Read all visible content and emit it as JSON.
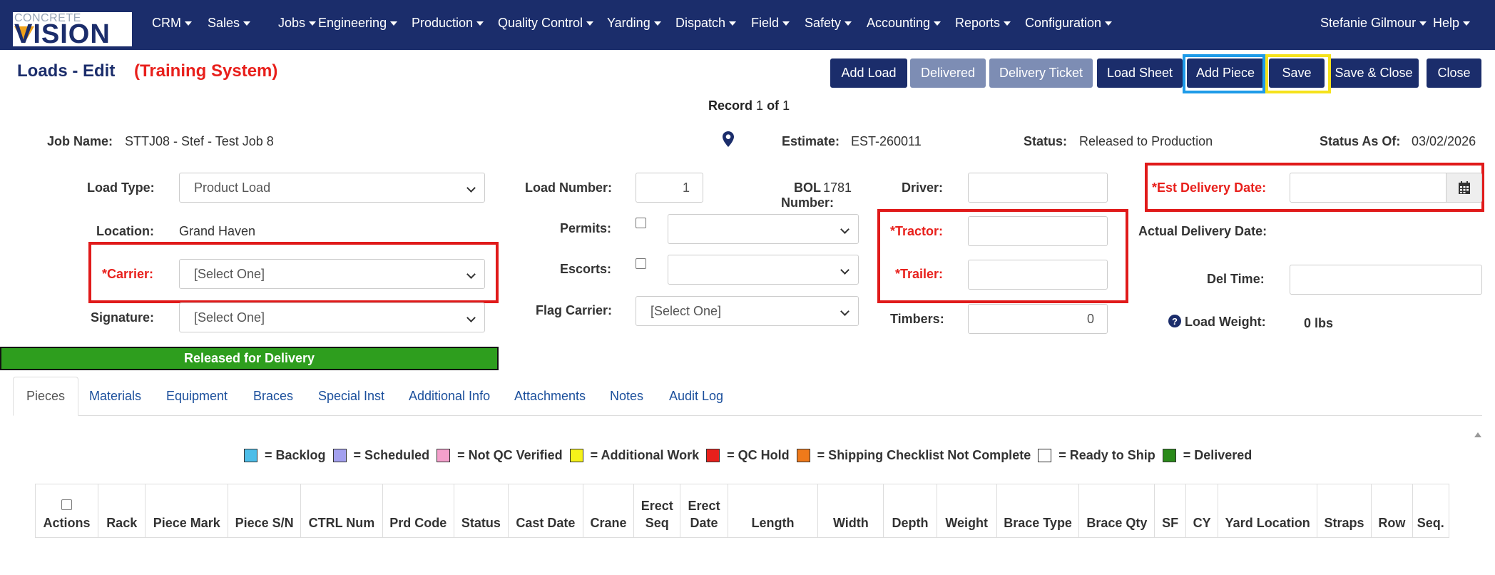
{
  "logo": {
    "top": "CONCRETE",
    "main": "VISION"
  },
  "nav": {
    "items": [
      "CRM",
      "Sales",
      "Jobs",
      "Engineering",
      "Production",
      "Quality Control",
      "Yarding",
      "Dispatch",
      "Field",
      "Safety",
      "Accounting",
      "Reports",
      "Configuration"
    ],
    "user": "Stefanie Gilmour",
    "help": "Help"
  },
  "page": {
    "title": "Loads - Edit",
    "system": "(Training System)"
  },
  "toolbar": {
    "add_load": "Add Load",
    "delivered": "Delivered",
    "delivery_ticket": "Delivery Ticket",
    "load_sheet": "Load Sheet",
    "add_piece": "Add Piece",
    "save": "Save",
    "save_close": "Save & Close",
    "close": "Close"
  },
  "record": {
    "label": "Record",
    "current": "1",
    "of": "of",
    "total": "1"
  },
  "header": {
    "job_name_label": "Job Name:",
    "job_name": "STTJ08 - Stef - Test Job 8",
    "estimate_label": "Estimate:",
    "estimate": "EST-260011",
    "status_label": "Status:",
    "status": "Released to Production",
    "status_as_of_label": "Status As Of:",
    "status_as_of": "03/02/2026"
  },
  "form": {
    "load_type_label": "Load Type:",
    "load_type": "Product Load",
    "location_label": "Location:",
    "location": "Grand Haven",
    "carrier_label": "*Carrier:",
    "carrier": "[Select One]",
    "signature_label": "Signature:",
    "signature": "[Select One]",
    "load_number_label": "Load Number:",
    "load_number": "1",
    "bol_label_1": "BOL",
    "bol_label_2": "Number:",
    "bol_number": "1781",
    "permits_label": "Permits:",
    "escorts_label": "Escorts:",
    "flag_carrier_label": "Flag Carrier:",
    "flag_carrier": "[Select One]",
    "driver_label": "Driver:",
    "tractor_label": "*Tractor:",
    "trailer_label": "*Trailer:",
    "timbers_label": "Timbers:",
    "timbers": "0",
    "est_delivery_label": "*Est Delivery Date:",
    "actual_delivery_label": "Actual Delivery Date:",
    "del_time_label": "Del Time:",
    "load_weight_label": "Load Weight:",
    "load_weight": "0 lbs"
  },
  "status_bar": "Released for Delivery",
  "tabs": [
    "Pieces",
    "Materials",
    "Equipment",
    "Braces",
    "Special Inst",
    "Additional Info",
    "Attachments",
    "Notes",
    "Audit Log"
  ],
  "legend": [
    {
      "label": "= Backlog",
      "color": "#4dbde8"
    },
    {
      "label": "= Scheduled",
      "color": "#a3a0ee"
    },
    {
      "label": "= Not QC Verified",
      "color": "#f4a0cc"
    },
    {
      "label": "= Additional Work",
      "color": "#f6f21a"
    },
    {
      "label": "= QC Hold",
      "color": "#e8201c"
    },
    {
      "label": "= Shipping Checklist Not Complete",
      "color": "#f07a1a"
    },
    {
      "label": "= Ready to Ship",
      "color": "#ffffff"
    },
    {
      "label": "= Delivered",
      "color": "#2a8a1a"
    }
  ],
  "table": {
    "columns": [
      "Actions",
      "Rack",
      "Piece Mark",
      "Piece S/N",
      "CTRL Num",
      "Prd Code",
      "Status",
      "Cast Date",
      "Crane",
      "Erect Seq",
      "Erect Date",
      "Length",
      "Width",
      "Depth",
      "Weight",
      "Brace Type",
      "Brace Qty",
      "SF",
      "CY",
      "Yard Location",
      "Straps",
      "Row",
      "Seq."
    ]
  }
}
